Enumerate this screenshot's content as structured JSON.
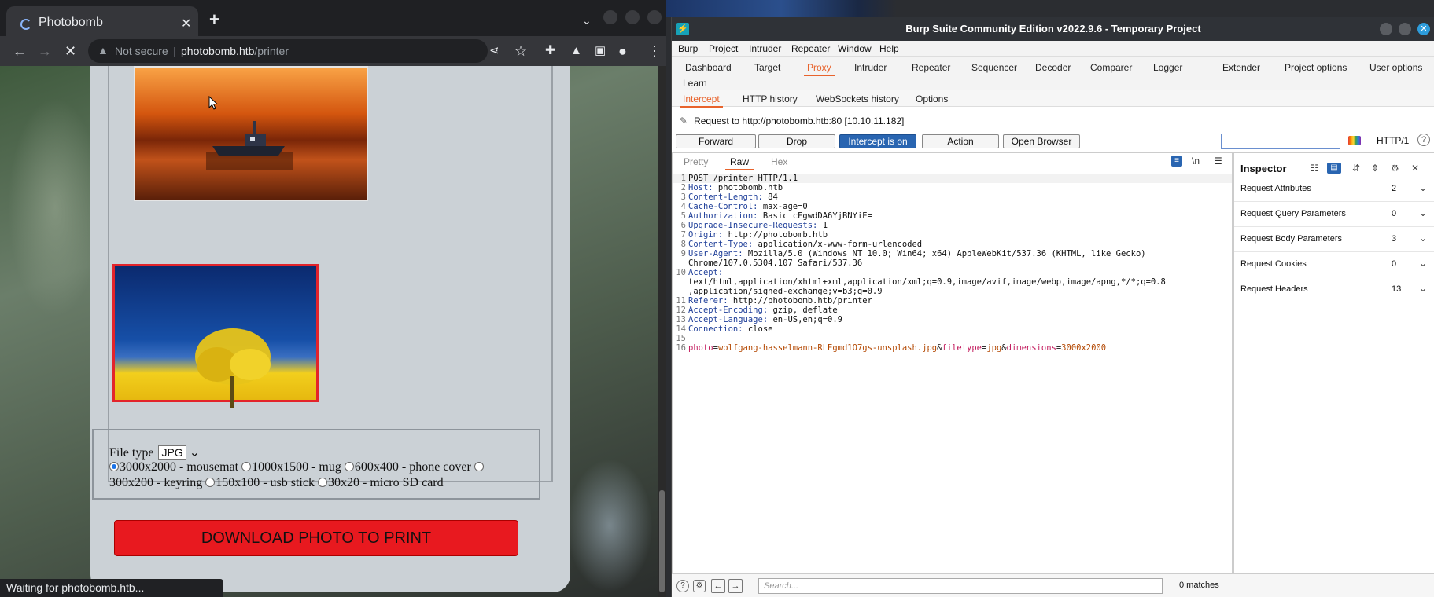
{
  "chrome": {
    "tab_title": "Photobomb",
    "tab_close": "✕",
    "new_tab": "+",
    "security_text": "Not secure",
    "url_host": "photobomb.htb",
    "url_path": "/printer",
    "status_text": "Waiting for photobomb.htb..."
  },
  "printer_page": {
    "file_type_label": "File type",
    "file_type_value": "JPG",
    "sizes": [
      {
        "label": "3000x2000 - mousemat",
        "selected": true
      },
      {
        "label": "1000x1500 - mug",
        "selected": false
      },
      {
        "label": "600x400 - phone cover",
        "selected": false
      },
      {
        "label": "300x200 - keyring",
        "selected": false
      },
      {
        "label": "150x100 - usb stick",
        "selected": false
      },
      {
        "label": "30x20 - micro SD card",
        "selected": false
      }
    ],
    "download_label": "DOWNLOAD PHOTO TO PRINT"
  },
  "burp": {
    "window_title": "Burp Suite Community Edition v2022.9.6 - Temporary Project",
    "menu": [
      "Burp",
      "Project",
      "Intruder",
      "Repeater",
      "Window",
      "Help"
    ],
    "main_tabs": [
      "Dashboard",
      "Target",
      "Proxy",
      "Intruder",
      "Repeater",
      "Sequencer",
      "Decoder",
      "Comparer",
      "Logger",
      "Extender",
      "Project options",
      "User options",
      "Learn"
    ],
    "active_main_tab": "Proxy",
    "proxy_tabs": [
      "Intercept",
      "HTTP history",
      "WebSockets history",
      "Options"
    ],
    "active_proxy_tab": "Intercept",
    "request_to": "Request to http://photobomb.htb:80  [10.10.11.182]",
    "buttons": {
      "forward": "Forward",
      "drop": "Drop",
      "intercept": "Intercept is on",
      "action": "Action",
      "open_browser": "Open Browser"
    },
    "protocol": "HTTP/1",
    "editor_tabs": [
      "Pretty",
      "Raw",
      "Hex"
    ],
    "active_editor_tab": "Raw",
    "newline_toggle": "\\n",
    "request_lines": [
      {
        "n": "1",
        "text": "POST /printer HTTP/1.1"
      },
      {
        "n": "2",
        "key": "Host",
        "val": " photobomb.htb"
      },
      {
        "n": "3",
        "key": "Content-Length",
        "val": " 84"
      },
      {
        "n": "4",
        "key": "Cache-Control",
        "val": " max-age=0"
      },
      {
        "n": "5",
        "key": "Authorization",
        "val": " Basic cEgwdDA6YjBNYiE="
      },
      {
        "n": "6",
        "key": "Upgrade-Insecure-Requests",
        "val": " 1"
      },
      {
        "n": "7",
        "key": "Origin",
        "val": " http://photobomb.htb"
      },
      {
        "n": "8",
        "key": "Content-Type",
        "val": " application/x-www-form-urlencoded"
      },
      {
        "n": "9",
        "key": "User-Agent",
        "val": " Mozilla/5.0 (Windows NT 10.0; Win64; x64) AppleWebKit/537.36 (KHTML, like Gecko)"
      },
      {
        "n": "",
        "text": "Chrome/107.0.5304.107 Safari/537.36"
      },
      {
        "n": "10",
        "key": "Accept",
        "val": ""
      },
      {
        "n": "",
        "text": "text/html,application/xhtml+xml,application/xml;q=0.9,image/avif,image/webp,image/apng,*/*;q=0.8"
      },
      {
        "n": "",
        "text": ",application/signed-exchange;v=b3;q=0.9"
      },
      {
        "n": "11",
        "key": "Referer",
        "val": " http://photobomb.htb/printer"
      },
      {
        "n": "12",
        "key": "Accept-Encoding",
        "val": " gzip, deflate"
      },
      {
        "n": "13",
        "key": "Accept-Language",
        "val": " en-US,en;q=0.9"
      },
      {
        "n": "14",
        "key": "Connection",
        "val": " close"
      },
      {
        "n": "15",
        "text": ""
      }
    ],
    "body_line_number": "16",
    "body_params": [
      {
        "k": "photo",
        "v": "wolfgang-hasselmann-RLEgmd1O7gs-unsplash.jpg"
      },
      {
        "k": "filetype",
        "v": "jpg"
      },
      {
        "k": "dimensions",
        "v": "3000x2000"
      }
    ],
    "inspector": {
      "title": "Inspector",
      "rows": [
        {
          "label": "Request Attributes",
          "count": "2"
        },
        {
          "label": "Request Query Parameters",
          "count": "0"
        },
        {
          "label": "Request Body Parameters",
          "count": "3"
        },
        {
          "label": "Request Cookies",
          "count": "0"
        },
        {
          "label": "Request Headers",
          "count": "13"
        }
      ]
    },
    "search_placeholder": "Search...",
    "matches": "0 matches"
  }
}
